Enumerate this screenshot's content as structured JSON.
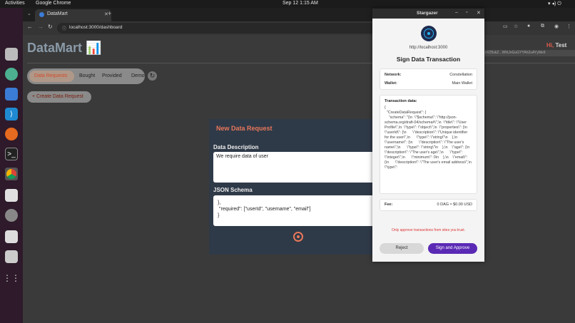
{
  "os": {
    "activities": "Activities",
    "app_name": "Google Chrome",
    "clock": "Sep 12  1:15 AM"
  },
  "browser": {
    "tab_title": "DataMart",
    "url": "localhost:3000/dashboard"
  },
  "app": {
    "logo": "DataMart 📊",
    "greeting_hi": "Hi,",
    "greeting_name": "Test",
    "address": "cV25skZ...WhUnGuGYYAh2uAYyMe9",
    "tabs": [
      "Data Requests",
      "Bought",
      "Provided",
      "Demo"
    ],
    "create_button": "+ Create Data Request"
  },
  "dialog": {
    "title": "New Data Request",
    "desc_label": "Data Description",
    "desc_value": "We require data of user",
    "schema_label": "JSON Schema",
    "schema_lines": [
      "},",
      "\"required\": [\"userId\", \"username\", \"email\"]",
      "}"
    ]
  },
  "extension": {
    "window_title": "Stargazer",
    "origin": "http://localhost:3000",
    "heading": "Sign Data Transaction",
    "network_label": "Network:",
    "network_value": "Constellation",
    "wallet_label": "Wallet:",
    "wallet_value": "Main Wallet",
    "tx_label": "Transaction data:",
    "tx_text": "{\n  \"CreateDataRequest\": {\n    \"schema\": \"{\\n  \\\"$schema\\\": \\\"http://json-schema.org/draft-04/schema#\\\",\\n  \\\"title\\\": \\\"User Profile\\\",\\n  \\\"type\\\": \\\"object\\\",\\n  \\\"properties\\\": {\\n    \\\"userId\\\": {\\n      \\\"description\\\": \\\"Unique identifier for the user\\\",\\n      \\\"type\\\": \\\"string\\\"\\n    },\\n    \\\"username\\\": {\\n      \\\"description\\\": \\\"The user's name\\\",\\n      \\\"type\\\": \\\"string\\\"\\n    },\\n    \\\"age\\\": {\\n      \\\"description\\\": \\\"The user's age\\\",\\n      \\\"type\\\": \\\"integer\\\",\\n      \\\"minimum\\\": 0\\n    },\\n    \\\"email\\\": {\\n      \\\"description\\\": \\\"The user's email address\\\",\\n      \\\"type\\\":",
    "fee_label": "Fee:",
    "fee_value": "0 DAG ≈ $0.00 USD",
    "warning": "Only approve transactions from sites you trust.",
    "reject": "Reject",
    "approve": "Sign and Approve"
  },
  "colors": {
    "accent_purple": "#5b2ab5",
    "warning_red": "#d33",
    "dialog_title": "#e8775a"
  }
}
